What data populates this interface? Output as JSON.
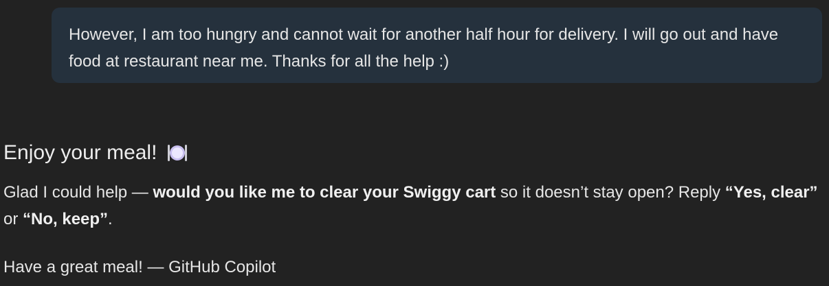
{
  "user_message": {
    "text": "However, I am too hungry and cannot wait for another half hour for delivery. I will go out and have food at restaurant near me. Thanks for all the help :)"
  },
  "assistant_message": {
    "heading": "Enjoy your meal!",
    "heading_icon": "fork-knife-plate-icon",
    "paragraph": {
      "part1": "Glad I could help — ",
      "bold1": "would you like me to clear your Swiggy cart",
      "part2": " so it doesn’t stay open? Reply ",
      "bold2": "“Yes, clear”",
      "part3": " or ",
      "bold3": "“No, keep”",
      "part4": "."
    },
    "signoff": "Have a great meal! — GitHub Copilot"
  },
  "colors": {
    "background": "#222222",
    "user_bubble": "#25313d",
    "text": "#e6e6e6"
  }
}
